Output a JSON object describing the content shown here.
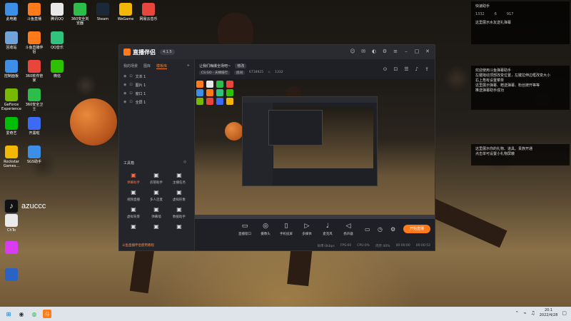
{
  "desktop": {
    "icons_col1": [
      {
        "label": "此电脑",
        "icon": "computer-icon",
        "color": "#3d8ee6"
      },
      {
        "label": "回收站",
        "icon": "recycle-bin-icon",
        "color": "#6fa3d9"
      },
      {
        "label": "控制面板",
        "icon": "control-panel-icon",
        "color": "#3d8ee6"
      },
      {
        "label": "GeForce Experience",
        "icon": "geforce-icon",
        "color": "#76b900"
      },
      {
        "label": "爱奇艺",
        "icon": "iqiyi-icon",
        "color": "#00be06"
      },
      {
        "label": "Rockstar Games...",
        "icon": "rockstar-icon",
        "color": "#f2b705"
      }
    ],
    "icons_col2": [
      {
        "label": "斗鱼直播",
        "icon": "douyu-icon",
        "color": "#ff7a1a"
      },
      {
        "label": "斗鱼直播伴侣",
        "icon": "douyu-companion-icon",
        "color": "#ff7a1a"
      },
      {
        "label": "360软件管家",
        "icon": "360-software-icon",
        "color": "#e8463c"
      },
      {
        "label": "360安全卫士",
        "icon": "360-security-icon",
        "color": "#2cbd4a"
      },
      {
        "label": "开黑啦",
        "icon": "kaiheila-icon",
        "color": "#3d6af2"
      },
      {
        "label": "SGS助手",
        "icon": "sgs-icon",
        "color": "#3d8ee6"
      }
    ],
    "icons_col3": [
      {
        "label": "腾讯QQ",
        "icon": "qq-icon",
        "color": "#e8e8e8"
      },
      {
        "label": "QQ音乐",
        "icon": "qq-music-icon",
        "color": "#31c27c"
      },
      {
        "label": "微信",
        "icon": "wechat-icon",
        "color": "#2dc100"
      }
    ],
    "icons_top": [
      {
        "label": "360安全浏览器",
        "icon": "360-browser-icon",
        "color": "#2cbd4a"
      },
      {
        "label": "Steam",
        "icon": "steam-icon",
        "color": "#1b2838"
      },
      {
        "label": "WeGame",
        "icon": "wegame-icon",
        "color": "#f2b705"
      },
      {
        "label": "网易云音乐",
        "icon": "netease-music-icon",
        "color": "#e8463c"
      }
    ],
    "icons_lower": [
      {
        "label": "ChTo",
        "icon": "tiktok-file-icon",
        "color": "#eaeaea"
      },
      {
        "label": "",
        "icon": "media-player-icon",
        "color": "#d93cf2"
      },
      {
        "label": "",
        "icon": "word-doc-icon",
        "color": "#2b63c4"
      }
    ],
    "tiktok_watermark": "azuccc"
  },
  "notices": {
    "top": {
      "title": "快速助手",
      "stats": [
        "1332",
        "6",
        "917"
      ],
      "line": "这里展示水友送礼弹幕"
    },
    "middle": "欢迎使用斗鱼弹幕助手\n左键拖动顶部改变位置，左键拉伸边框改变大小\n右上角有设置菜单\n这里展示弹幕、赠送弹幕、粉丝牌开等等\n推送弹幕助手成功",
    "bottom": "这里展示你的礼物、道具、贵族开通\n点击单可设置小礼物屏蔽"
  },
  "app": {
    "brand": "直播伴侣",
    "version": "4.1.5",
    "left_tabs": [
      "我的场景",
      "图库",
      "模板库"
    ],
    "active_tab": "模板库",
    "scenes": [
      "文本 1",
      "图片 1",
      "窗口 1",
      "全屏 1"
    ],
    "tools_title": "工具箱",
    "tools": [
      {
        "label": "弹幕助手",
        "icon": "danmaku-icon",
        "hot": true
      },
      {
        "label": "房管助手",
        "icon": "room-admin-icon",
        "hot": false
      },
      {
        "label": "主播任务",
        "icon": "anchor-task-icon",
        "hot": false
      },
      {
        "label": "视频直播",
        "icon": "video-live-icon",
        "hot": false
      },
      {
        "label": "多人连麦",
        "icon": "multi-mic-icon",
        "hot": false
      },
      {
        "label": "虚拟形象",
        "icon": "avatar-icon",
        "hot": false
      },
      {
        "label": "虚拟背景",
        "icon": "virtual-bg-icon",
        "hot": false
      },
      {
        "label": "弹幕墙",
        "icon": "danmaku-wall-icon",
        "hot": false
      },
      {
        "label": "数据助手",
        "icon": "data-helper-icon",
        "hot": false
      },
      {
        "label": "",
        "icon": "more-tool-icon",
        "hot": false
      },
      {
        "label": "",
        "icon": "gift-tool-icon",
        "hot": false
      },
      {
        "label": "",
        "icon": "game-tool-icon",
        "hot": false
      }
    ],
    "left_status": "斗鱼直播伴侣使用教程",
    "room_title": "让我们嗨爆全场吧~",
    "edit_chip": "修改",
    "category": "CS:GO - 天梯排行",
    "room_chip": "房间",
    "room_id": "6718925",
    "hot_count": "1332",
    "bottom_tools": [
      {
        "label": "直播窗口",
        "icon": "monitor-icon"
      },
      {
        "label": "摄像头",
        "icon": "camera-icon"
      },
      {
        "label": "手机投屏",
        "icon": "phone-cast-icon"
      },
      {
        "label": "多媒体",
        "icon": "media-icon"
      },
      {
        "label": "麦克风",
        "icon": "microphone-icon"
      },
      {
        "label": "扬声器",
        "icon": "speaker-icon"
      }
    ],
    "go_live": "开始直播",
    "status": [
      "码率:0kbps",
      "FPS:60",
      "CPU:0%",
      "内存:40%",
      "00:00:00",
      "00:00:52"
    ]
  },
  "taskbar": {
    "time": "20:1",
    "date": "2022/4/28"
  }
}
